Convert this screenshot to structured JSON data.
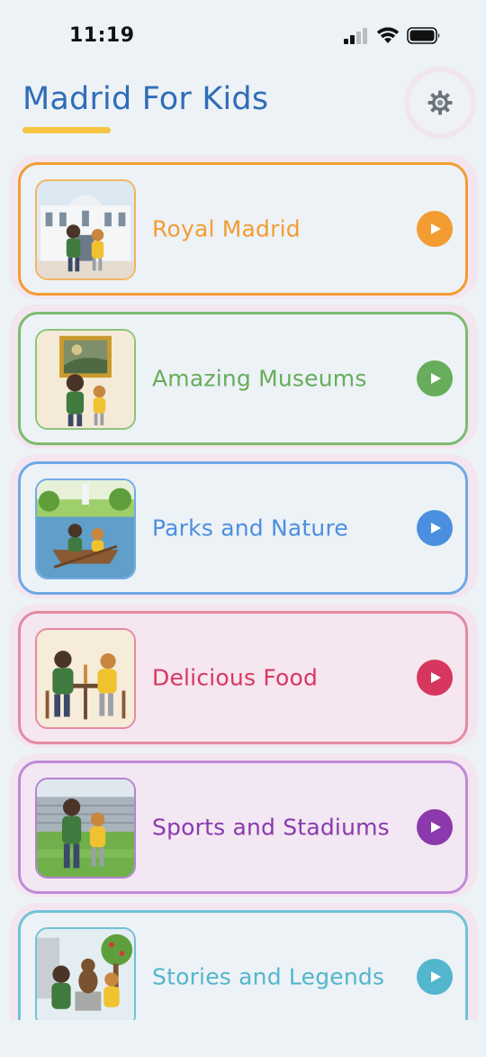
{
  "status_bar": {
    "time": "11:19"
  },
  "header": {
    "title": "Madrid For Kids"
  },
  "categories": [
    {
      "label": "Royal Madrid",
      "color": "#f39c32",
      "icon": "royal-palace-illustration"
    },
    {
      "label": "Amazing Museums",
      "color": "#67ad5b",
      "icon": "museum-painting-illustration"
    },
    {
      "label": "Parks and Nature",
      "color": "#4c8fe0",
      "icon": "park-boat-illustration"
    },
    {
      "label": "Delicious Food",
      "color": "#d7375f",
      "icon": "food-churros-illustration"
    },
    {
      "label": "Sports and Stadiums",
      "color": "#8b39ad",
      "icon": "stadium-illustration"
    },
    {
      "label": "Stories and Legends",
      "color": "#52b6cd",
      "icon": "bear-statue-illustration"
    }
  ],
  "colors": {
    "background": "#edf2f6",
    "title": "#2f6db8",
    "underline": "#f5c542"
  }
}
